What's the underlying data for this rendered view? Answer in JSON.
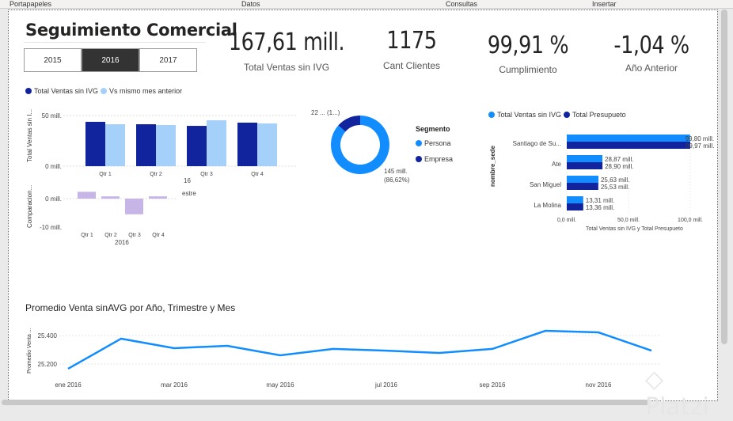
{
  "ribbon": [
    "Portapapeles",
    "Datos",
    "Consultas",
    "Insertar"
  ],
  "header": {
    "title": "Seguimiento Comercial"
  },
  "slicer": {
    "options": [
      "2015",
      "2016",
      "2017"
    ],
    "selected": "2016"
  },
  "kpis": [
    {
      "value": "167,61 mill.",
      "label": "Total Ventas  sin IVG"
    },
    {
      "value": "1175",
      "label": "Cant Clientes"
    },
    {
      "value": "99,91 %",
      "label": "Cumplimiento"
    },
    {
      "value": "-1,04 %",
      "label": "Año Anterior"
    }
  ],
  "colors": {
    "dark": "#12239e",
    "light": "#a5d0fa",
    "accent": "#118dff",
    "purple": "#c7b5e8"
  },
  "watermark": "Platzi",
  "chart_data": [
    {
      "type": "bar",
      "legend": [
        "Total Ventas  sin IVG",
        "Vs mismo mes anterior"
      ],
      "ylabel": "Total Ventas sin I...",
      "categories": [
        "Qtr 1",
        "Qtr 2",
        "Qtr 3",
        "Qtr 4"
      ],
      "yticks": [
        "50 mill.",
        "0 mill."
      ],
      "ylim": [
        0,
        50
      ],
      "series": [
        {
          "name": "Total Ventas  sin IVG",
          "values": [
            43.8,
            41.4,
            39.8,
            43.0
          ]
        },
        {
          "name": "Vs mismo mes anterior",
          "values": [
            41.4,
            40.6,
            45.3,
            42.2
          ]
        }
      ],
      "extra_labels": [
        "16",
        "estre"
      ]
    },
    {
      "type": "bar",
      "ylabel": "Comparacion...",
      "categories": [
        "Qtr 1",
        "Qtr 2",
        "Qtr 3",
        "Qtr 4"
      ],
      "xlabel": "2016",
      "yticks": [
        "0 mill.",
        "-10 mill."
      ],
      "ylim": [
        -10,
        0
      ],
      "values": [
        2.4,
        0.8,
        -5.5,
        0.8
      ]
    },
    {
      "type": "pie",
      "legend_title": "Segmento",
      "slices": [
        {
          "name": "Persona",
          "percent": 86.62,
          "label": "145 mill.",
          "label2": "(86,62%)"
        },
        {
          "name": "Empresa",
          "percent": 13.38,
          "label": "22 ... (1...)"
        }
      ]
    },
    {
      "type": "bar",
      "orientation": "horizontal",
      "legend": [
        "Total Ventas  sin IVG",
        "Total Presupueto"
      ],
      "ylabel": "nombre_sede",
      "xlabel": "Total Ventas sin IVG y Total Presupueto",
      "xticks": [
        "0,0 mill.",
        "50,0 mill.",
        "100,0 mill."
      ],
      "xlim": [
        0,
        100
      ],
      "categories": [
        "Santiago de Su...",
        "Ate",
        "San Miguel",
        "La Molina"
      ],
      "series": [
        {
          "name": "Total Ventas  sin IVG",
          "values": [
            99.8,
            28.87,
            25.63,
            13.31
          ],
          "labels": [
            "99,80 mill.",
            "28,87 mill.",
            "25,63 mill.",
            "13,31 mill."
          ]
        },
        {
          "name": "Total Presupueto",
          "values": [
            99.97,
            28.9,
            25.53,
            13.36
          ],
          "labels": [
            "99,97 mill.",
            "28,90 mill.",
            "25,53 mill.",
            "13,36 mill."
          ]
        }
      ]
    },
    {
      "type": "line",
      "title": "Promedio Venta sinAVG por Año, Trimestre y Mes",
      "ylabel": "Promedio Venta ...",
      "yticks": [
        "25.400",
        "25.200"
      ],
      "ylim": [
        25150,
        25460
      ],
      "x": [
        "ene 2016",
        "feb 2016",
        "mar 2016",
        "abr 2016",
        "may 2016",
        "jun 2016",
        "jul 2016",
        "ago 2016",
        "sep 2016",
        "oct 2016",
        "nov 2016",
        "dic 2016"
      ],
      "xticks": [
        "ene 2016",
        "mar 2016",
        "may 2016",
        "jul 2016",
        "sep 2016",
        "nov 2016"
      ],
      "values": [
        25167,
        25378,
        25311,
        25328,
        25261,
        25306,
        25294,
        25278,
        25306,
        25433,
        25422,
        25294
      ]
    }
  ]
}
